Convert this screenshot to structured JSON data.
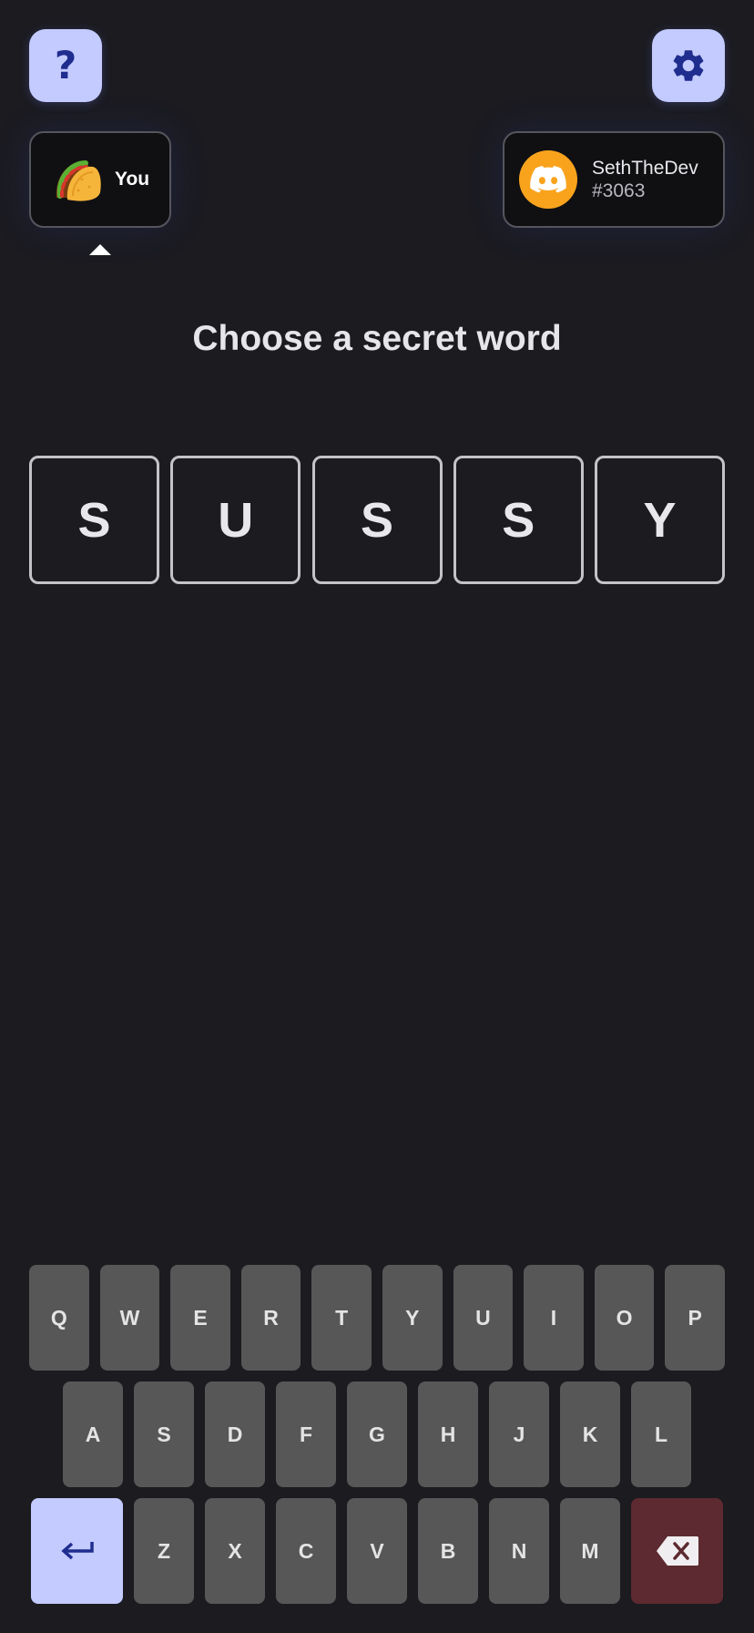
{
  "header": {
    "help_icon": "question-mark-icon",
    "help_glyph": "?",
    "settings_icon": "gear-icon"
  },
  "players": {
    "you": {
      "avatar_icon": "taco-icon",
      "label": "You"
    },
    "opponent": {
      "avatar_icon": "discord-logo-icon",
      "name": "SethTheDev",
      "tag": "#3063"
    }
  },
  "prompt": {
    "title": "Choose a secret word"
  },
  "word": {
    "letters": [
      "S",
      "U",
      "S",
      "S",
      "Y"
    ]
  },
  "keyboard": {
    "row1": [
      "Q",
      "W",
      "E",
      "R",
      "T",
      "Y",
      "U",
      "I",
      "O",
      "P"
    ],
    "row2": [
      "A",
      "S",
      "D",
      "F",
      "G",
      "H",
      "J",
      "K",
      "L"
    ],
    "row3": [
      "Z",
      "X",
      "C",
      "V",
      "B",
      "N",
      "M"
    ],
    "enter_icon": "enter-arrow-icon",
    "backspace_icon": "backspace-icon"
  },
  "colors": {
    "background": "#1b1b20",
    "accent": "#c3cbff",
    "accent_dark": "#1f2d8f",
    "key": "#575757",
    "backspace": "#5c2a30",
    "discord_orange": "#f9a31d"
  }
}
